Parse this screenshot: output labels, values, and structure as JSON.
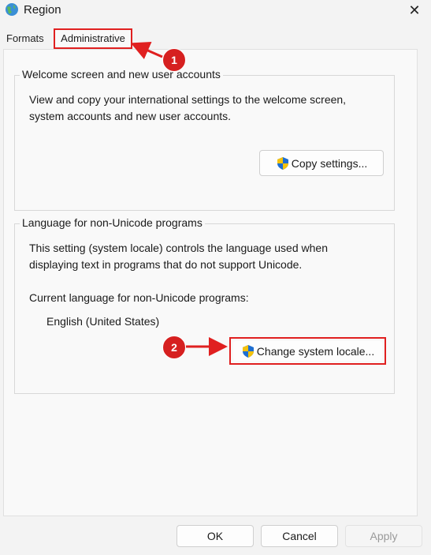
{
  "window": {
    "title": "Region",
    "close_glyph": "✕"
  },
  "tabs": [
    {
      "label": "Formats",
      "selected": false
    },
    {
      "label": "Administrative",
      "selected": true
    }
  ],
  "welcome_group": {
    "label": "Welcome screen and new user accounts",
    "description_line1": "View and copy your international settings to the welcome screen,",
    "description_line2": "system accounts and new user accounts.",
    "copy_button": "Copy settings..."
  },
  "locale_group": {
    "label": "Language for non-Unicode programs",
    "description_line1": "This setting (system locale) controls the language used when",
    "description_line2": "displaying text in programs that do not support Unicode.",
    "current_label": "Current language for non-Unicode programs:",
    "current_value": "English (United States)",
    "change_button": "Change system locale..."
  },
  "footer": {
    "ok": "OK",
    "cancel": "Cancel",
    "apply": "Apply"
  },
  "annotations": {
    "marker_1": "1",
    "marker_2": "2"
  },
  "colors": {
    "annotation_red": "#e02020",
    "accent_blue": "#0067c0"
  },
  "icons": [
    "globe-icon",
    "close-icon",
    "shield-icon"
  ]
}
